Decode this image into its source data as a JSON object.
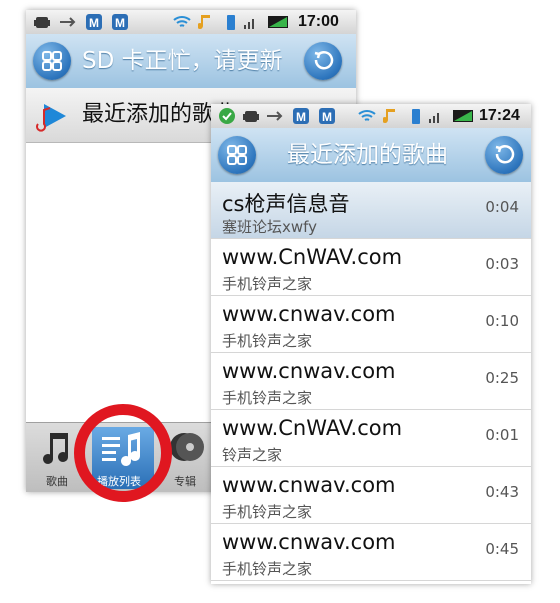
{
  "back_screen": {
    "status_time": "17:00",
    "title": "SD 卡正忙，请更新",
    "subheader": "最近添加的歌曲",
    "tabs": [
      {
        "label": "歌曲"
      },
      {
        "label": "播放列表"
      },
      {
        "label": "专辑"
      }
    ]
  },
  "front_screen": {
    "status_time": "17:24",
    "title": "最近添加的歌曲",
    "songs": [
      {
        "title": "cs枪声信息音",
        "artist": "塞班论坛xwfy",
        "duration": "0:04"
      },
      {
        "title": "www.CnWAV.com",
        "artist": "手机铃声之家",
        "duration": "0:03"
      },
      {
        "title": "www.cnwav.com",
        "artist": "手机铃声之家",
        "duration": "0:10"
      },
      {
        "title": "www.cnwav.com",
        "artist": "手机铃声之家",
        "duration": "0:25"
      },
      {
        "title": "www.CnWAV.com",
        "artist": "铃声之家",
        "duration": "0:01"
      },
      {
        "title": "www.cnwav.com",
        "artist": "手机铃声之家",
        "duration": "0:43"
      },
      {
        "title": "www.cnwav.com",
        "artist": "手机铃声之家",
        "duration": "0:45"
      }
    ]
  },
  "colors": {
    "title_bar": "#9cc3e1",
    "button_blue": "#2d75bd",
    "highlight_circle": "#e01720"
  }
}
